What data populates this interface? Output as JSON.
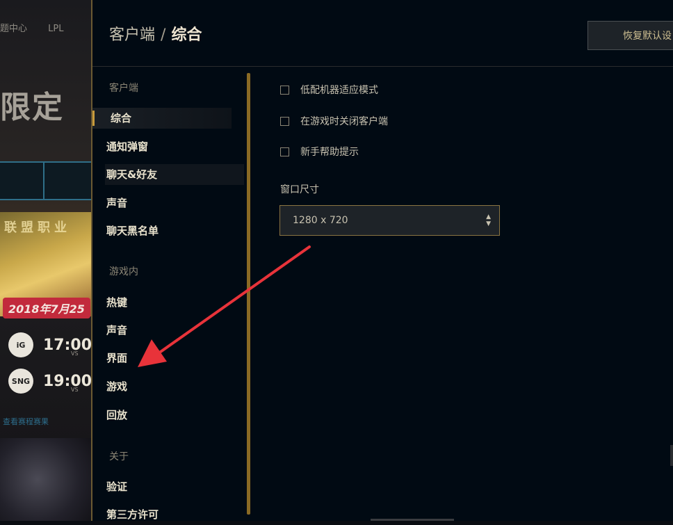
{
  "background": {
    "nav": [
      "题中心",
      "LPL"
    ],
    "promo_text": "限定",
    "banner_title": "联盟职业",
    "date_badge": "2018年7月25",
    "matches": [
      {
        "logo": "iG",
        "time": "17:00",
        "vs": "VS"
      },
      {
        "logo": "SNG",
        "time": "19:00",
        "vs": "VS"
      }
    ],
    "link_text": "查看赛程赛果"
  },
  "modal": {
    "breadcrumb": {
      "section": "客户端",
      "separator": "/",
      "current": "综合"
    },
    "restore_button": "恢复默认设",
    "sidebar": {
      "client_header": "客户端",
      "client_items": [
        "综合",
        "通知弹窗",
        "聊天&好友",
        "声音",
        "聊天黑名单"
      ],
      "ingame_header": "游戏内",
      "ingame_items": [
        "热键",
        "声音",
        "界面",
        "游戏",
        "回放"
      ],
      "about_header": "关于",
      "about_items": [
        "验证",
        "第三方许可"
      ]
    },
    "options": [
      {
        "label": "低配机器适应模式",
        "checked": false
      },
      {
        "label": "在游戏时关闭客户端",
        "checked": false
      },
      {
        "label": "新手帮助提示",
        "checked": false
      }
    ],
    "window_size": {
      "label": "窗口尺寸",
      "value": "1280 x 720"
    }
  },
  "colors": {
    "accent": "#c89b3c",
    "arrow": "#e8333a",
    "modal_bg": "#010a13"
  }
}
